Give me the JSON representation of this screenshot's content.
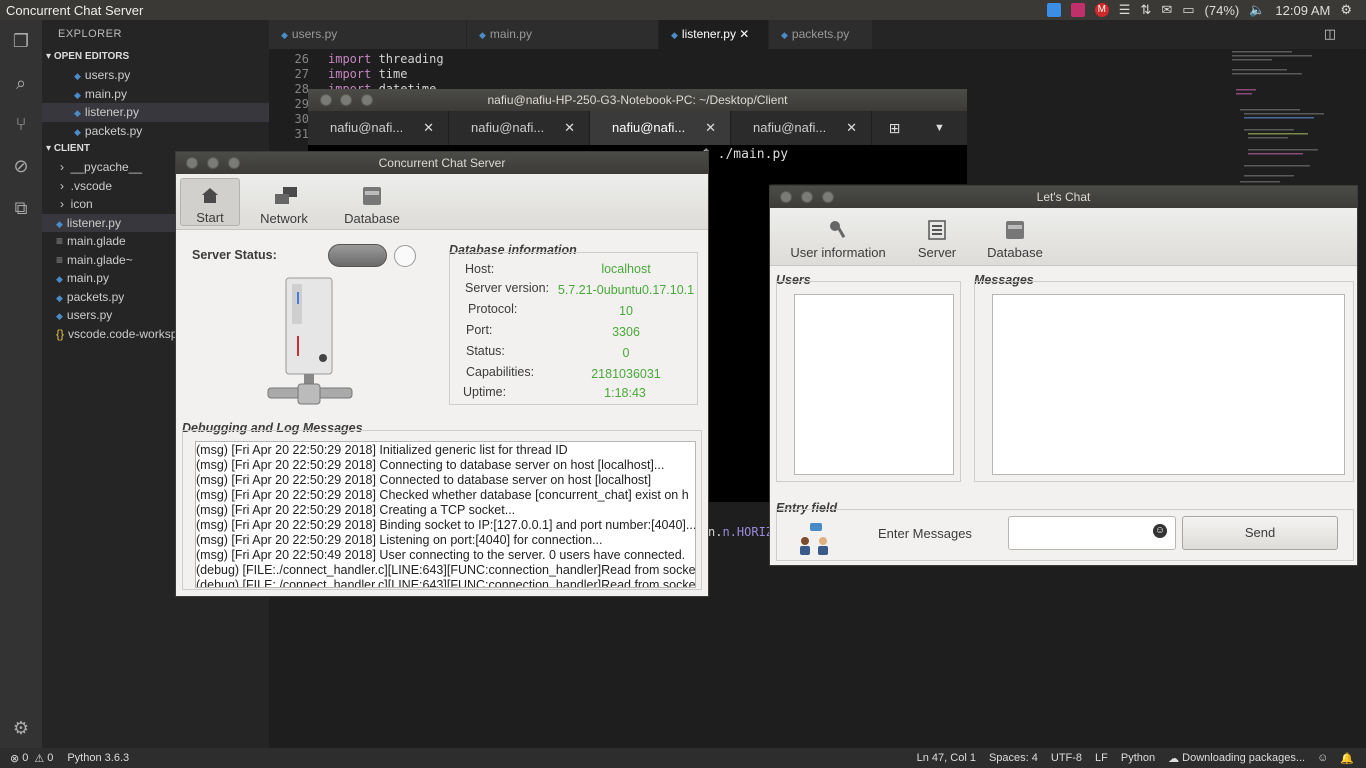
{
  "topbar": {
    "title": "Concurrent Chat Server",
    "battery": "(74%)",
    "time": "12:09 AM"
  },
  "explorer": {
    "header": "EXPLORER",
    "open_editors_label": "OPEN EDITORS",
    "open_editors": [
      "users.py",
      "main.py",
      "listener.py",
      "packets.py"
    ],
    "client_label": "CLIENT",
    "folders": [
      "__pycache__",
      ".vscode",
      "icon"
    ],
    "files": [
      "listener.py",
      "main.glade",
      "main.glade~",
      "main.py",
      "packets.py",
      "users.py",
      "vscode.code-workspa"
    ]
  },
  "tabs": [
    "users.py",
    "main.py",
    "listener.py",
    "packets.py"
  ],
  "editor": {
    "line_numbers": [
      "26",
      "27",
      "28",
      "29",
      "30",
      "31"
    ],
    "line26_kw": "import",
    "line26_rest": " threading",
    "line27_kw": "import",
    "line27_rest": " time",
    "line28_kw": "import",
    "line28_rest": " datetime",
    "fragment": "n.HORIZON"
  },
  "statusbar": {
    "errors": "0",
    "warnings": "0",
    "python": "Python 3.6.3",
    "position": "Ln 47, Col 1",
    "spaces": "Spaces: 4",
    "encoding": "UTF-8",
    "eol": "LF",
    "language": "Python",
    "downloading": "Downloading packages..."
  },
  "terminal": {
    "title": "nafiu@nafiu-HP-250-G3-Notebook-PC: ~/Desktop/Client",
    "tabs": [
      "nafiu@nafi...",
      "nafiu@nafi...",
      "nafiu@nafi...",
      "nafiu@nafi..."
    ],
    "prompt_tail": "$ ./main.py"
  },
  "server_window": {
    "title": "Concurrent Chat Server",
    "toolbar": [
      "Start",
      "Network",
      "Database"
    ],
    "status_label": "Server Status:",
    "db_info_label": "Database information",
    "db_rows": [
      {
        "label": "Host:",
        "value": "localhost"
      },
      {
        "label": "Server version:",
        "value": "5.7.21-0ubuntu0.17.10.1"
      },
      {
        "label": "Protocol:",
        "value": "10"
      },
      {
        "label": "Port:",
        "value": "3306"
      },
      {
        "label": "Status:",
        "value": "0"
      },
      {
        "label": "Capabilities:",
        "value": "2181036031"
      },
      {
        "label": "Uptime:",
        "value": "1:18:43"
      }
    ],
    "log_label": "Debugging and Log Messages",
    "log": [
      "(msg) [Fri Apr 20 22:50:29 2018] Initialized generic list for thread ID",
      "(msg) [Fri Apr 20 22:50:29 2018] Connecting to database server on host [localhost]...",
      "(msg) [Fri Apr 20 22:50:29 2018] Connected to database server on host [localhost]",
      "(msg) [Fri Apr 20 22:50:29 2018] Checked whether database [concurrent_chat] exist on h",
      "(msg) [Fri Apr 20 22:50:29 2018] Creating a TCP socket...",
      "(msg) [Fri Apr 20 22:50:29 2018] Binding socket to IP:[127.0.0.1] and port number:[4040]...",
      "(msg) [Fri Apr 20 22:50:29 2018] Listening on port:[4040] for connection...",
      "(msg) [Fri Apr 20 22:50:49 2018] User connecting to the server. 0 users have connected.",
      "(debug) [FILE:./connect_handler.c][LINE:643][FUNC:connection_handler]Read from socket",
      "(debug) [FILE:./connect_handler.c][LINE:643][FUNC:connection_handler]Read from socket"
    ]
  },
  "chat_window": {
    "title": "Let's Chat",
    "toolbar": [
      "User information",
      "Server",
      "Database"
    ],
    "users_label": "Users",
    "messages_label": "Messages",
    "entry_label": "Entry field",
    "enter_label": "Enter Messages",
    "send": "Send"
  }
}
